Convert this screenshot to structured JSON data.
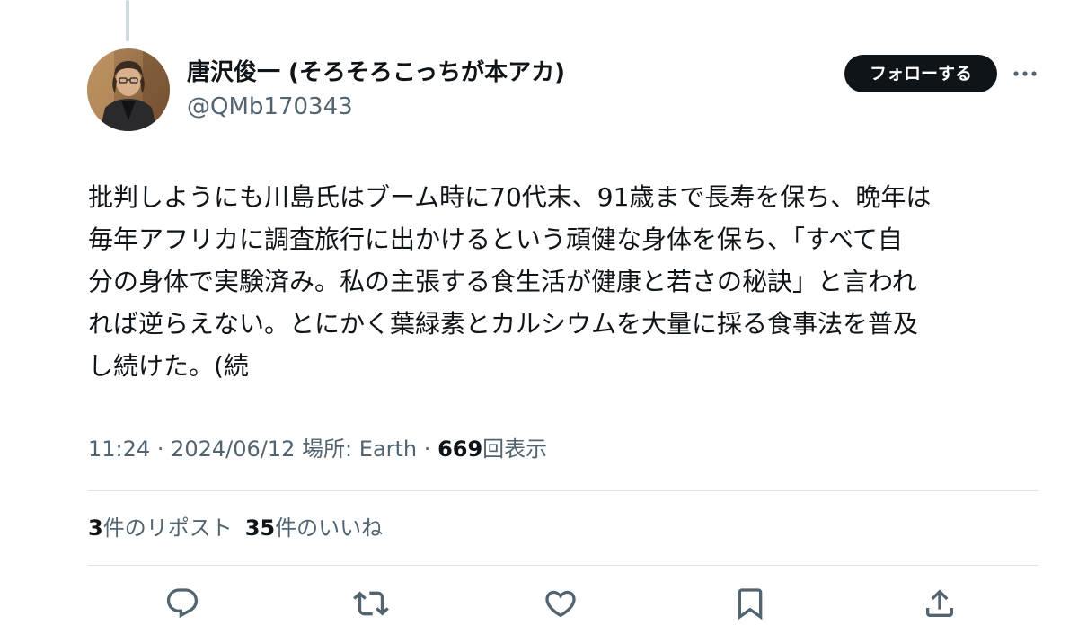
{
  "author": {
    "display_name": "唐沢俊一 (そろそろこっちが本アカ)",
    "handle": "@QMb170343",
    "avatar_icon": "avatar-photo"
  },
  "follow_button_label": "フォローする",
  "more_icon": "more-icon",
  "tweet": {
    "lines": [
      "批判しようにも川島氏はブーム時に70代末、91歳まで長寿を保ち、晩年は",
      "毎年アフリカに調査旅行に出かけるという頑健な身体を保ち、「すべて自",
      "分の身体で実験済み。私の主張する食生活が健康と若さの秘訣」と言われ",
      "れば逆らえない。とにかく葉緑素とカルシウムを大量に採る食事法を普及",
      "し続けた。(続"
    ]
  },
  "meta": {
    "time": "11:24",
    "date": "2024/06/12",
    "location_label": "場所: Earth",
    "views_count": "669",
    "views_label": "回表示",
    "separator": "·"
  },
  "stats": {
    "reposts_count": "3",
    "reposts_label": "件のリポスト",
    "likes_count": "35",
    "likes_label": "件のいいね"
  },
  "actions": [
    {
      "icon": "reply-icon"
    },
    {
      "icon": "repost-icon"
    },
    {
      "icon": "like-icon"
    },
    {
      "icon": "bookmark-icon"
    },
    {
      "icon": "share-icon"
    }
  ],
  "colors": {
    "text_primary": "#0f1419",
    "text_secondary": "#536471",
    "button_bg": "#0f1419",
    "divider": "#dfe4e8"
  }
}
